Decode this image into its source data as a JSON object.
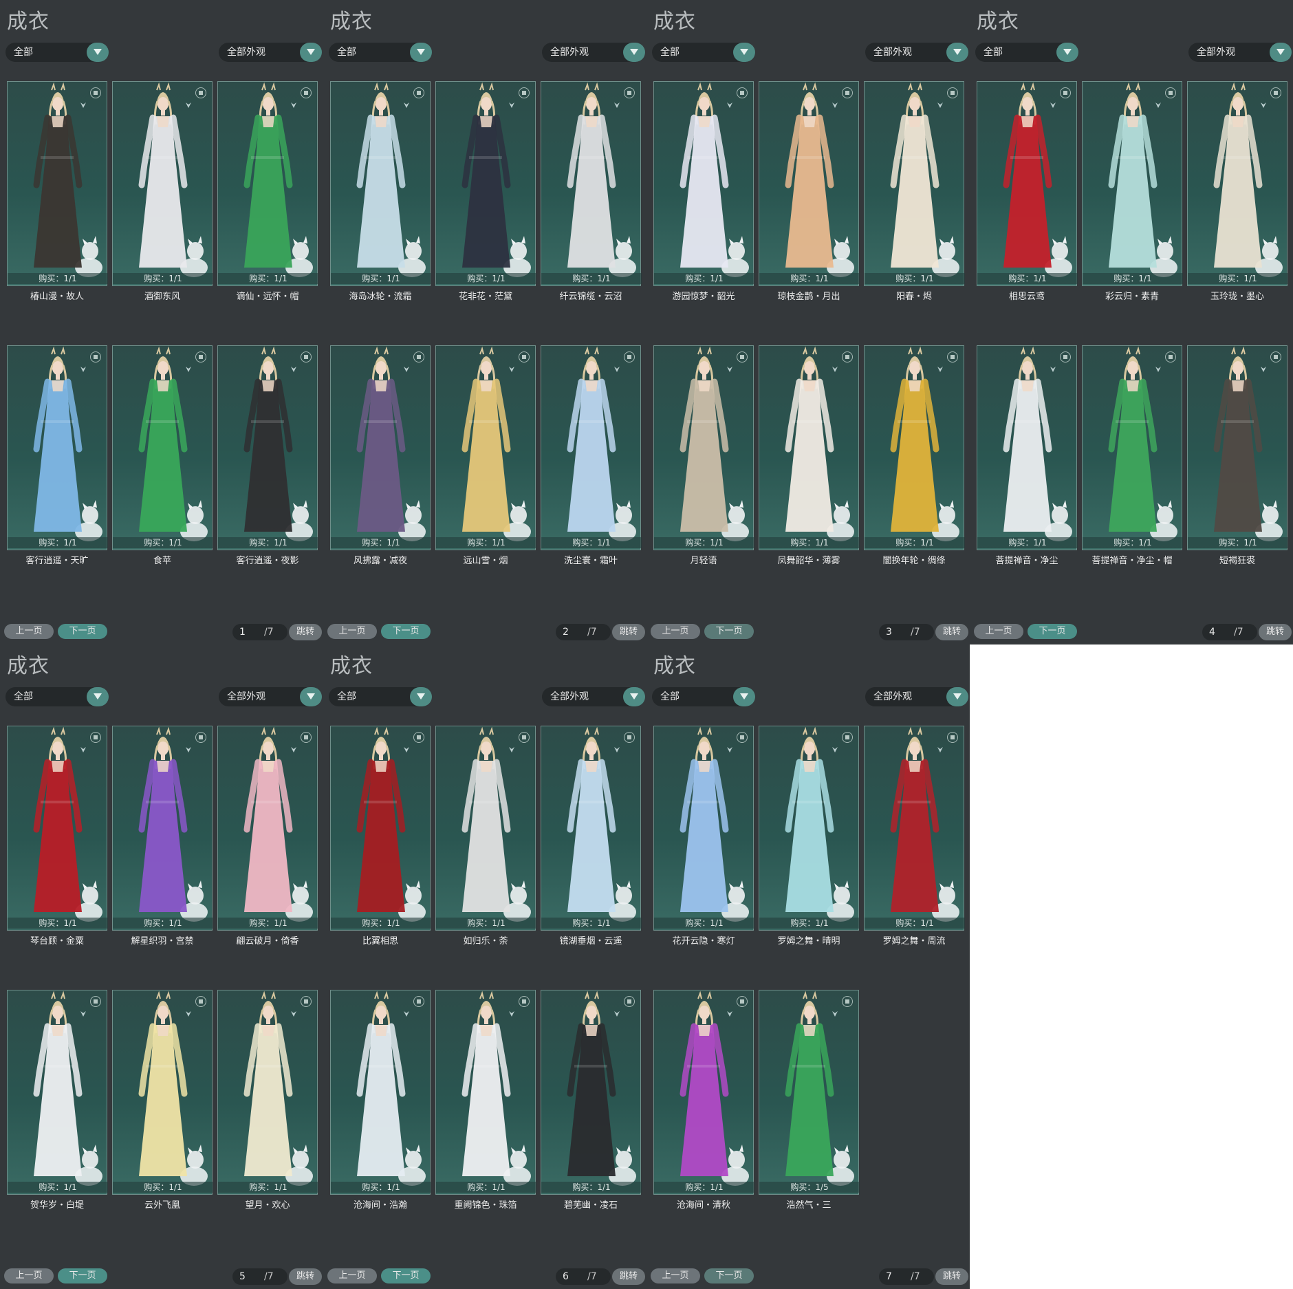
{
  "common": {
    "title": "成衣",
    "filter_left": "全部",
    "filter_right": "全部外观",
    "prev_label": "上一页",
    "next_label": "下一页",
    "jump_label": "跳转"
  },
  "panels": [
    {
      "page": "1",
      "total": "/7",
      "items": [
        {
          "name": "椿山漫・故人",
          "buy": "购买：1/1",
          "color": "#3b3631"
        },
        {
          "name": "酒御东风",
          "buy": "购买：1/1",
          "color": "#e9e9ec"
        },
        {
          "name": "谪仙・远怀・帽",
          "buy": "购买：1/1",
          "color": "#3aa45a"
        },
        {
          "name": "客行逍遥・天旷",
          "buy": "购买：1/1",
          "color": "#7fb7e6"
        },
        {
          "name": "食苹",
          "buy": "购买：1/1",
          "color": "#39a85a"
        },
        {
          "name": "客行逍遥・夜影",
          "buy": "购买：1/1",
          "color": "#2f2f31"
        }
      ]
    },
    {
      "page": "2",
      "total": "/7",
      "items": [
        {
          "name": "海岛冰轮・流霜",
          "buy": "购买：1/1",
          "color": "#c7dde8"
        },
        {
          "name": "花非花・茫黛",
          "buy": "购买：1/1",
          "color": "#2d3140"
        },
        {
          "name": "纤云锦缆・云沼",
          "buy": "购买：1/1",
          "color": "#dfe0e3"
        },
        {
          "name": "风拂露・减夜",
          "buy": "购买：1/1",
          "color": "#6b5a85"
        },
        {
          "name": "远山雪・烟",
          "buy": "购买：1/1",
          "color": "#e6c779"
        },
        {
          "name": "洗尘寰・霜叶",
          "buy": "购买：1/1",
          "color": "#bcd6ef"
        }
      ]
    },
    {
      "page": "3",
      "total": "/7",
      "items": [
        {
          "name": "游园惊梦・韶光",
          "buy": "购买：1/1",
          "color": "#e7e8f2"
        },
        {
          "name": "琼枝金鹊・月出",
          "buy": "购买：1/1",
          "color": "#e9b98f"
        },
        {
          "name": "阳春・烬",
          "buy": "购买：1/1",
          "color": "#f0e6d5"
        },
        {
          "name": "月轻语",
          "buy": "购买：1/1",
          "color": "#cbbea9"
        },
        {
          "name": "凤舞韶华・薄雾",
          "buy": "购买：1/1",
          "color": "#f1ebe4"
        },
        {
          "name": "闇换年轮・绸绦",
          "buy": "购买：1/1",
          "color": "#e0b33a"
        }
      ]
    },
    {
      "page": "4",
      "total": "/7",
      "items": [
        {
          "name": "相思云鸢",
          "buy": "购买：1/1",
          "color": "#c4212b"
        },
        {
          "name": "彩云归・素青",
          "buy": "购买：1/1",
          "color": "#b5dedb"
        },
        {
          "name": "玉玲珑・墨心",
          "buy": "购买：1/1",
          "color": "#e9e2d2"
        },
        {
          "name": "菩提禅音・净尘",
          "buy": "购买：1/1",
          "color": "#ebeef0"
        },
        {
          "name": "菩提禅音・净尘・帽",
          "buy": "购买：1/1",
          "color": "#3ea65c"
        },
        {
          "name": "短褐狂裘",
          "buy": "购买：1/1",
          "color": "#514a44"
        }
      ]
    },
    {
      "page": "5",
      "total": "/7",
      "items": [
        {
          "name": "琴台顾・金粟",
          "buy": "购买：1/1",
          "color": "#b81e27"
        },
        {
          "name": "解星织羽・宫禁",
          "buy": "购买：1/1",
          "color": "#8a57c9"
        },
        {
          "name": "翩云破月・倚香",
          "buy": "购买：1/1",
          "color": "#f0b7c4"
        },
        {
          "name": "贺华岁・白堤",
          "buy": "购买：1/1",
          "color": "#eef0f2"
        },
        {
          "name": "云外飞凰",
          "buy": "购买：1/1",
          "color": "#f0e4a6"
        },
        {
          "name": "望月・欢心",
          "buy": "购买：1/1",
          "color": "#f0ead0"
        }
      ]
    },
    {
      "page": "6",
      "total": "/7",
      "items": [
        {
          "name": "比翼相思",
          "buy": "购买：1/1",
          "color": "#a51d22"
        },
        {
          "name": "如归乐・荼",
          "buy": "购买：1/1",
          "color": "#e2e2e2"
        },
        {
          "name": "镜湖垂烟・云遥",
          "buy": "购买：1/1",
          "color": "#c4ddf0"
        },
        {
          "name": "沧海间・浩瀚",
          "buy": "购买：1/1",
          "color": "#e5ecf1"
        },
        {
          "name": "重阙锦色・珠箔",
          "buy": "购买：1/1",
          "color": "#eff0f2"
        },
        {
          "name": "碧芜幽・凌石",
          "buy": "购买：1/1",
          "color": "#2a2b2e"
        }
      ]
    },
    {
      "page": "7",
      "total": "/7",
      "items": [
        {
          "name": "花开云隐・寒灯",
          "buy": "购买：1/1",
          "color": "#9cc3ee"
        },
        {
          "name": "罗姆之舞・晴明",
          "buy": "购买：1/1",
          "color": "#a9dde3"
        },
        {
          "name": "罗姆之舞・周流",
          "buy": "购买：1/1",
          "color": "#b1222a"
        },
        {
          "name": "沧海间・清秋",
          "buy": "购买：1/1",
          "color": "#b14ac6"
        },
        {
          "name": "浩然气・三",
          "buy": "购买：1/5",
          "color": "#3aa65b"
        }
      ]
    }
  ]
}
